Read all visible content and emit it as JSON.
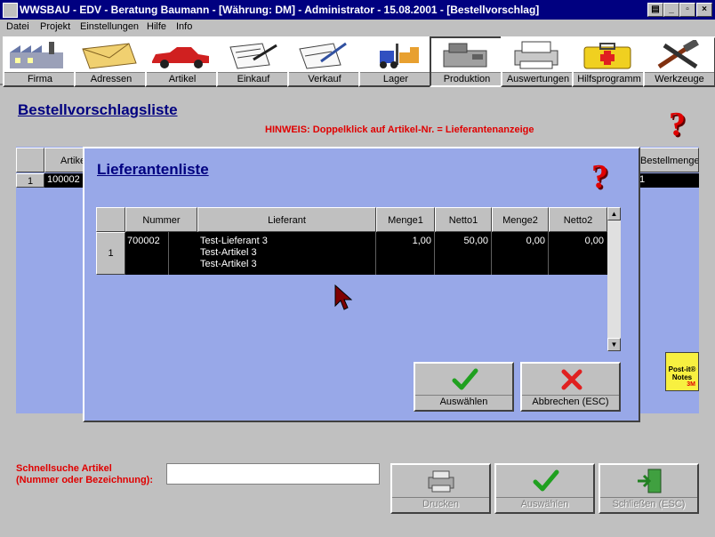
{
  "window": {
    "title": "WWSBAU - EDV - Beratung Baumann - [Währung: DM] - Administrator - 15.08.2001 - [Bestellvorschlag]"
  },
  "menu": [
    "Datei",
    "Projekt",
    "Einstellungen",
    "Hilfe",
    "Info"
  ],
  "toolbar": [
    {
      "label": "Firma",
      "icon": "factory-icon"
    },
    {
      "label": "Adressen",
      "icon": "envelope-icon"
    },
    {
      "label": "Artikel",
      "icon": "car-icon"
    },
    {
      "label": "Einkauf",
      "icon": "documents-icon"
    },
    {
      "label": "Verkauf",
      "icon": "pen-paper-icon"
    },
    {
      "label": "Lager",
      "icon": "forklift-icon"
    },
    {
      "label": "Produktion",
      "icon": "machine-icon"
    },
    {
      "label": "Auswertungen",
      "icon": "printer-icon"
    },
    {
      "label": "Hilfsprogramm",
      "icon": "first-aid-icon"
    },
    {
      "label": "Werkzeuge",
      "icon": "tools-icon"
    }
  ],
  "main": {
    "title": "Bestellvorschlagsliste",
    "hint": "HINWEIS: Doppelklick auf Artikel-Nr. = Lieferantenanzeige",
    "table": {
      "headers": {
        "col1": "Artike",
        "last": "Bestellmenge"
      },
      "row": {
        "num": "1",
        "artikel": "100002",
        "menge": "1"
      }
    },
    "search": {
      "label_line1": "Schnellsuche Artikel",
      "label_line2": "(Nummer oder Bezeichnung):",
      "value": ""
    },
    "buttons": {
      "print": "Drucken",
      "select": "Auswählen",
      "close": "Schließen (ESC)"
    },
    "postit": {
      "line1": "Post-it®",
      "line2": "Notes",
      "brand": "3M"
    }
  },
  "dialog": {
    "title": "Lieferantenliste",
    "headers": [
      "Nummer",
      "Lieferant",
      "Menge1",
      "Netto1",
      "Menge2",
      "Netto2"
    ],
    "row": {
      "num": "1",
      "nummer": "700002",
      "lieferant": [
        "Test-Lieferant 3",
        "Test-Artikel 3",
        "Test-Artikel 3"
      ],
      "menge1": "1,00",
      "netto1": "50,00",
      "menge2": "0,00",
      "netto2": "0,00"
    },
    "buttons": {
      "select": "Auswählen",
      "cancel": "Abbrechen (ESC)"
    }
  },
  "colors": {
    "titlebar": "#000080",
    "accent_red": "#e00000",
    "dialog_bg": "#98a8e8",
    "check_green": "#20a020"
  }
}
